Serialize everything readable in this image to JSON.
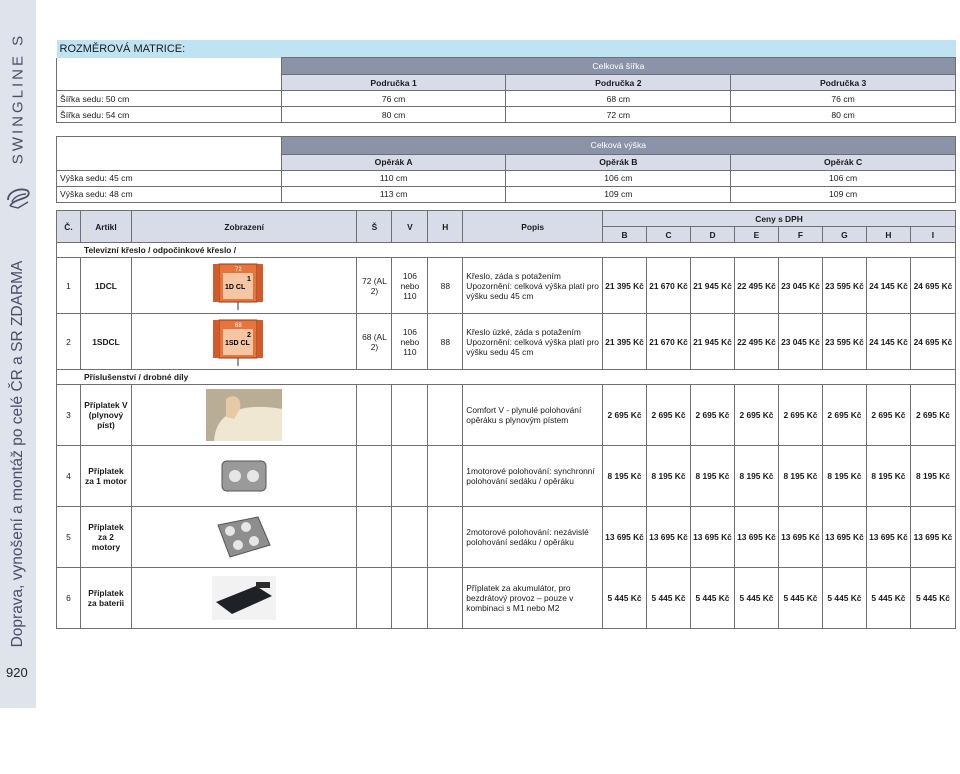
{
  "sidebar": {
    "brand": "SWINGLINE S",
    "delivery": "Doprava, vynošení a montáž po celé ČR a SR ZDARMA",
    "page_number": "920"
  },
  "width_matrix": {
    "title": "ROZMĚROVÁ MATRICE:",
    "group": "Celková šířka",
    "cols": [
      "Područka 1",
      "Područka 2",
      "Područka 3"
    ],
    "rows": [
      {
        "label": "Šířka sedu: 50 cm",
        "values": [
          "76 cm",
          "68 cm",
          "76 cm"
        ]
      },
      {
        "label": "Šířka sedu: 54 cm",
        "values": [
          "80 cm",
          "72 cm",
          "80 cm"
        ]
      }
    ]
  },
  "height_matrix": {
    "group": "Celková výška",
    "cols": [
      "Opěrák A",
      "Opěrák B",
      "Opěrák C"
    ],
    "rows": [
      {
        "label": "Výška sedu: 45 cm",
        "values": [
          "110 cm",
          "106 cm",
          "106 cm"
        ]
      },
      {
        "label": "Výška sedu: 48 cm",
        "values": [
          "113 cm",
          "109 cm",
          "109 cm"
        ]
      }
    ]
  },
  "pricelist": {
    "headers": {
      "num": "Č.",
      "article": "Artikl",
      "image": "Zobrazení",
      "s": "Š",
      "v": "V",
      "h": "H",
      "desc": "Popis",
      "prices": "Ceny s DPH"
    },
    "price_cols": [
      "B",
      "C",
      "D",
      "E",
      "F",
      "G",
      "H",
      "I"
    ],
    "section1": "Televizní křeslo / odpočinkové křeslo /",
    "section2": "Příslušenství / drobné díly",
    "rows": [
      {
        "num": "1",
        "article": "1DCL",
        "diagram": "1D CL",
        "diagram_top": "72",
        "diagram_idx": "1",
        "s": "72 (AL 2)",
        "v": "106 nebo 110",
        "h": "88",
        "desc": "Křeslo, záda s potažením Upozornění: celková výška platí pro výšku sedu 45 cm",
        "prices": [
          "21 395 Kč",
          "21 670 Kč",
          "21 945 Kč",
          "22 495 Kč",
          "23 045 Kč",
          "23 595 Kč",
          "24 145 Kč",
          "24 695 Kč"
        ]
      },
      {
        "num": "2",
        "article": "1SDCL",
        "diagram": "1SD CL",
        "diagram_top": "68",
        "diagram_idx": "2",
        "s": "68 (AL 2)",
        "v": "106 nebo 110",
        "h": "88",
        "desc": "Křeslo úzké, záda s potažením Upozornění: celková výška platí pro výšku sedu 45 cm",
        "prices": [
          "21 395 Kč",
          "21 670 Kč",
          "21 945 Kč",
          "22 495 Kč",
          "23 045 Kč",
          "23 595 Kč",
          "24 145 Kč",
          "24 695 Kč"
        ]
      },
      {
        "num": "3",
        "article": "Příplatek V (plynový píst)",
        "desc": "Comfort V - plynulé polohování opěráku s plynovým pístem",
        "prices": [
          "2 695 Kč",
          "2 695 Kč",
          "2 695 Kč",
          "2 695 Kč",
          "2 695 Kč",
          "2 695 Kč",
          "2 695 Kč",
          "2 695 Kč"
        ]
      },
      {
        "num": "4",
        "article": "Příplatek za 1 motor",
        "desc": "1motorové polohování: synchronní polohování sedáku / opěráku",
        "prices": [
          "8 195 Kč",
          "8 195 Kč",
          "8 195 Kč",
          "8 195 Kč",
          "8 195 Kč",
          "8 195 Kč",
          "8 195 Kč",
          "8 195 Kč"
        ]
      },
      {
        "num": "5",
        "article": "Příplatek za 2 motory",
        "desc": "2motorové polohování: nezávislé polohování sedáku / opěráku",
        "prices": [
          "13 695 Kč",
          "13 695 Kč",
          "13 695 Kč",
          "13 695 Kč",
          "13 695 Kč",
          "13 695 Kč",
          "13 695 Kč",
          "13 695 Kč"
        ]
      },
      {
        "num": "6",
        "article": "Příplatek za baterii",
        "desc": "Příplatek za akumulátor, pro bezdrátový provoz – pouze v kombinaci s M1 nebo M2",
        "prices": [
          "5 445 Kč",
          "5 445 Kč",
          "5 445 Kč",
          "5 445 Kč",
          "5 445 Kč",
          "5 445 Kč",
          "5 445 Kč",
          "5 445 Kč"
        ]
      }
    ]
  }
}
